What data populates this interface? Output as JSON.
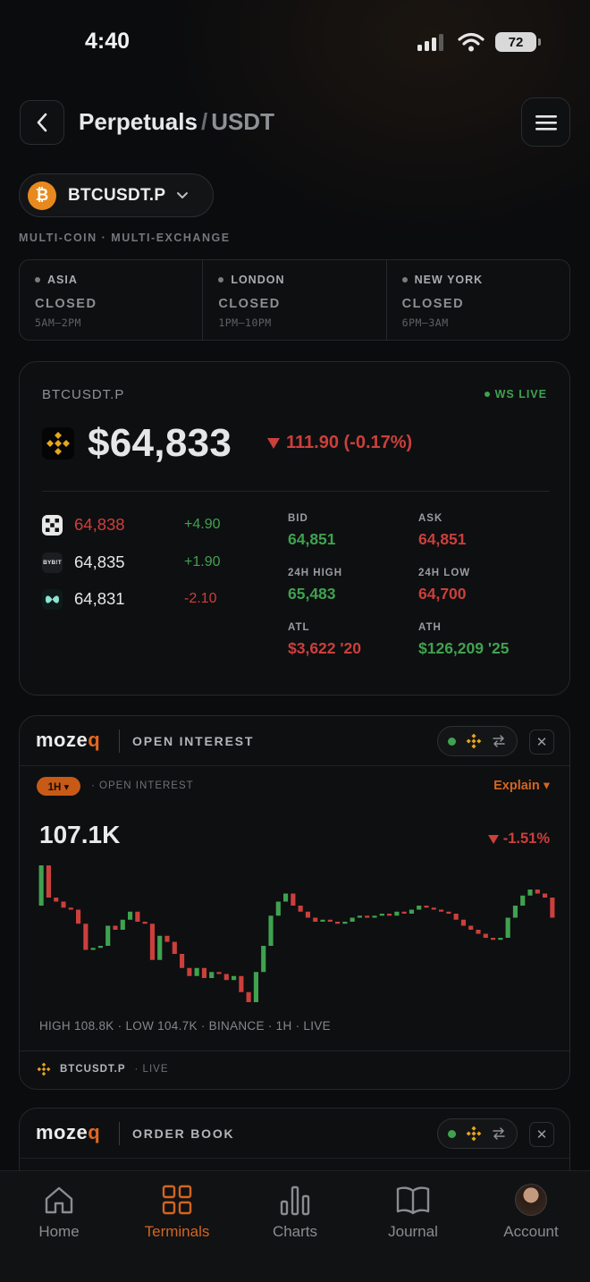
{
  "status_bar": {
    "time": "4:40",
    "battery": "72"
  },
  "header": {
    "title_main": "Perpetuals",
    "title_sep": "/",
    "title_sub": "USDT"
  },
  "pair": {
    "label": "BTCUSDT.P",
    "coin_glyph": "₿"
  },
  "tagline": "MULTI-COIN · MULTI-EXCHANGE",
  "sessions": [
    {
      "name": "ASIA",
      "state": "CLOSED",
      "hours": "5AM–2PM"
    },
    {
      "name": "LONDON",
      "state": "CLOSED",
      "hours": "1PM–10PM"
    },
    {
      "name": "NEW YORK",
      "state": "CLOSED",
      "hours": "6PM–3AM"
    }
  ],
  "price_card": {
    "symbol": "BTCUSDT.P",
    "ws_status": "WS LIVE",
    "price": "$64,833",
    "change": "111.90 (-0.17%)",
    "exchanges": [
      {
        "icon": "okx-icon",
        "price": "64,838",
        "delta": "+4.90"
      },
      {
        "icon": "bybit-icon",
        "icon_text": "BYB!T",
        "price": "64,835",
        "delta": "+1.90"
      },
      {
        "icon": "hyperliquid-icon",
        "price": "64,831",
        "delta": "-2.10"
      }
    ],
    "stats": {
      "bid_label": "BID",
      "bid": "64,851",
      "ask_label": "ASK",
      "ask": "64,851",
      "high_label": "24H HIGH",
      "high": "65,483",
      "low_label": "24H LOW",
      "low": "64,700",
      "atl_label": "ATL",
      "atl": "$3,622 '20",
      "ath_label": "ATH",
      "ath": "$126,209 '25"
    }
  },
  "oi_card": {
    "logo_main": "moze",
    "logo_accent": "q",
    "title": "OPEN INTEREST",
    "timeframe": "1H ▾",
    "subtitle": "· OPEN INTEREST",
    "explain": "Explain ▾",
    "value": "107.1K",
    "change": "-1.51%",
    "footer_stats": "HIGH 108.8K · LOW 104.7K · BINANCE · 1H · LIVE",
    "footer_symbol": "BTCUSDT.P",
    "footer_live": "· LIVE",
    "close": "✕"
  },
  "ob_card": {
    "logo_main": "moze",
    "logo_accent": "q",
    "title": "ORDER BOOK",
    "close": "✕"
  },
  "tabs": [
    {
      "label": "Home",
      "icon": "home-icon"
    },
    {
      "label": "Terminals",
      "icon": "grid-icon"
    },
    {
      "label": "Charts",
      "icon": "bar-chart-icon"
    },
    {
      "label": "Journal",
      "icon": "book-icon"
    },
    {
      "label": "Account",
      "icon": "avatar"
    }
  ],
  "colors": {
    "accent": "#d4651f",
    "up": "#3fa24f",
    "down": "#cc3f3b",
    "background": "#0b0c0e"
  },
  "chart_data": {
    "type": "candlestick",
    "title": "",
    "xlabel": "",
    "ylabel": "",
    "candles": [
      [
        107.85,
        108.85
      ],
      [
        108.85,
        108.05
      ],
      [
        108.05,
        107.95
      ],
      [
        107.95,
        107.8
      ],
      [
        107.8,
        107.75
      ],
      [
        107.75,
        107.4
      ],
      [
        107.4,
        106.75
      ],
      [
        106.75,
        106.8
      ],
      [
        106.8,
        106.85
      ],
      [
        106.85,
        107.35
      ],
      [
        107.35,
        107.25
      ],
      [
        107.25,
        107.5
      ],
      [
        107.5,
        107.7
      ],
      [
        107.7,
        107.45
      ],
      [
        107.45,
        107.4
      ],
      [
        107.4,
        106.5
      ],
      [
        106.5,
        107.1
      ],
      [
        107.1,
        106.95
      ],
      [
        106.95,
        106.65
      ],
      [
        106.65,
        106.3
      ],
      [
        106.3,
        106.1
      ],
      [
        106.1,
        106.3
      ],
      [
        106.3,
        106.05
      ],
      [
        106.05,
        106.2
      ],
      [
        106.2,
        106.15
      ],
      [
        106.15,
        106.0
      ],
      [
        106.0,
        106.1
      ],
      [
        106.1,
        105.7
      ],
      [
        105.7,
        105.45
      ],
      [
        105.45,
        106.2
      ],
      [
        106.2,
        106.85
      ],
      [
        106.85,
        107.6
      ],
      [
        107.6,
        107.95
      ],
      [
        107.95,
        108.15
      ],
      [
        108.15,
        107.85
      ],
      [
        107.85,
        107.7
      ],
      [
        107.7,
        107.55
      ],
      [
        107.55,
        107.45
      ],
      [
        107.45,
        107.5
      ],
      [
        107.5,
        107.45
      ],
      [
        107.45,
        107.4
      ],
      [
        107.4,
        107.45
      ],
      [
        107.45,
        107.55
      ],
      [
        107.55,
        107.6
      ],
      [
        107.6,
        107.55
      ],
      [
        107.55,
        107.6
      ],
      [
        107.6,
        107.65
      ],
      [
        107.65,
        107.6
      ],
      [
        107.6,
        107.7
      ],
      [
        107.7,
        107.65
      ],
      [
        107.65,
        107.75
      ],
      [
        107.75,
        107.85
      ],
      [
        107.85,
        107.8
      ],
      [
        107.8,
        107.75
      ],
      [
        107.75,
        107.7
      ],
      [
        107.7,
        107.65
      ],
      [
        107.65,
        107.5
      ],
      [
        107.5,
        107.35
      ],
      [
        107.35,
        107.25
      ],
      [
        107.25,
        107.15
      ],
      [
        107.15,
        107.05
      ],
      [
        107.05,
        107.0
      ],
      [
        107.0,
        107.05
      ],
      [
        107.05,
        107.55
      ],
      [
        107.55,
        107.85
      ],
      [
        107.85,
        108.1
      ],
      [
        108.1,
        108.25
      ],
      [
        108.25,
        108.15
      ],
      [
        108.15,
        108.05
      ],
      [
        108.05,
        107.55
      ]
    ]
  }
}
